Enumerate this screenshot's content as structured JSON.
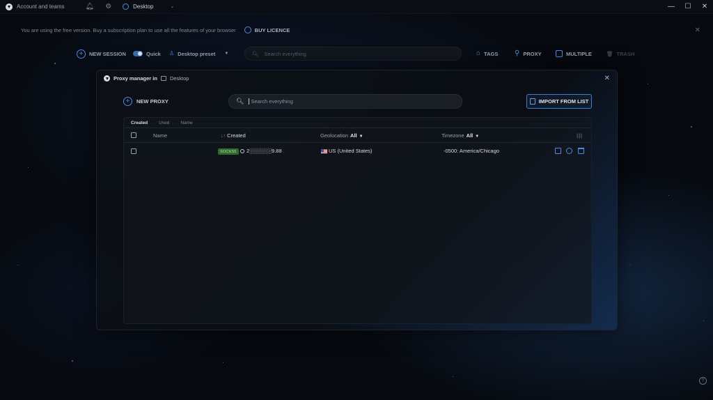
{
  "titlebar": {
    "account_label": "Account and teams",
    "workspace_label": "Desktop",
    "icons": [
      "app-logo",
      "bell-icon",
      "gear-icon",
      "workspace-icon",
      "chevron-down-icon",
      "minimize-icon",
      "maximize-icon",
      "close-icon"
    ]
  },
  "banner": {
    "message": "You are using the free version. Buy a subscription plan to use all the features of your browser",
    "buy_label": "BUY LICENCE"
  },
  "toolbar": {
    "new_session": "NEW SESSION",
    "quick_label": "Quick",
    "quick_enabled": true,
    "preset_label": "Desktop preset",
    "search_placeholder": "Search everything",
    "tags": "TAGS",
    "proxy": "PROXY",
    "multiple": "MULTIPLE",
    "trash": "TRASH"
  },
  "modal": {
    "title": "Proxy manager in",
    "workspace": "Desktop",
    "new_proxy": "NEW PROXY",
    "search_placeholder": "Search everything",
    "import_label": "IMPORT FROM LIST",
    "tabs": [
      "Created",
      "Used",
      "Name"
    ],
    "active_tab": "Created",
    "columns": {
      "name": "Name",
      "created": "Created",
      "created_sort": "↓↑",
      "geolocation": "Geolocation",
      "geolocation_filter": "All",
      "timezone": "Timezone",
      "timezone_filter": "All"
    },
    "rows": [
      {
        "type_badge": "SOCKS5",
        "address": "2░░░░░░9.88",
        "geolocation": "US (United States)",
        "timezone": "-0500: America/Chicago"
      }
    ]
  },
  "colors": {
    "accent": "#4b8de0",
    "badge_bg": "#2f6a2f",
    "background": "#06090f"
  }
}
